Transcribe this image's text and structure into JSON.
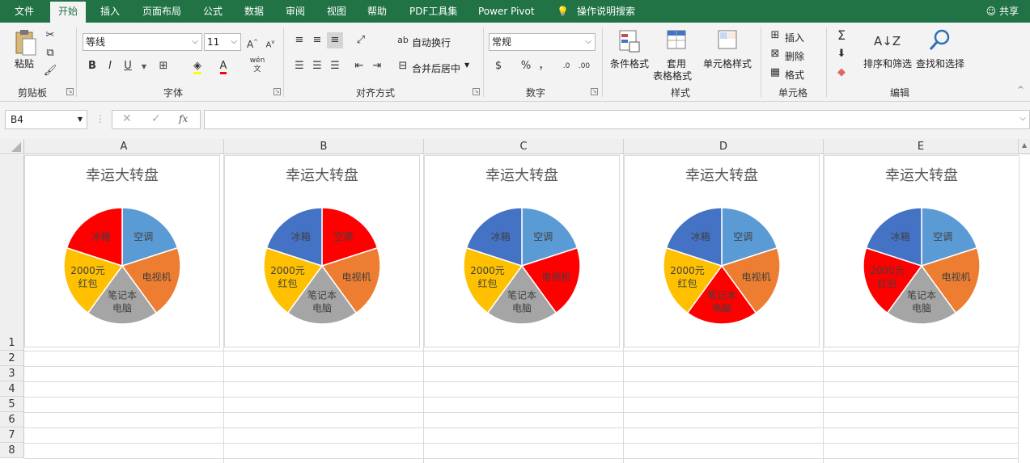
{
  "menu": {
    "tabs": [
      "文件",
      "开始",
      "插入",
      "页面布局",
      "公式",
      "数据",
      "审阅",
      "视图",
      "帮助",
      "PDF工具集",
      "Power Pivot"
    ],
    "search": "操作说明搜索",
    "share": "共享"
  },
  "ribbon": {
    "clipboard": {
      "paste": "粘贴",
      "label": "剪贴板"
    },
    "font": {
      "name": "等线",
      "size": "11",
      "bold": "B",
      "italic": "I",
      "underline": "U",
      "phonetic": "wén",
      "label": "字体"
    },
    "alignment": {
      "wrap": "自动换行",
      "merge": "合并后居中",
      "label": "对齐方式"
    },
    "number": {
      "format": "常规",
      "percent": "%",
      "comma": "，",
      "label": "数字"
    },
    "styles": {
      "conditional": "条件格式",
      "table_line1": "套用",
      "table_line2": "表格格式",
      "cell_styles": "单元格样式",
      "label": "样式"
    },
    "cells": {
      "insert": "插入",
      "delete": "删除",
      "format": "格式",
      "label": "单元格"
    },
    "editing": {
      "sort": "排序和筛选",
      "find": "查找和选择",
      "label": "编辑"
    }
  },
  "formula_bar": {
    "name_box": "B4",
    "fx": "fx",
    "value": ""
  },
  "columns": [
    "A",
    "B",
    "C",
    "D",
    "E"
  ],
  "rows": [
    "1",
    "2",
    "3",
    "4",
    "5",
    "6",
    "7",
    "8"
  ],
  "colors": {
    "blue_light": "#5b9bd5",
    "orange": "#ed7d31",
    "gray": "#a5a5a5",
    "yellow": "#ffc000",
    "red": "#ff0000",
    "blue_dark": "#4472c4",
    "excel_green": "#217346"
  },
  "chart_data": [
    {
      "type": "pie",
      "title": "幸运大转盘",
      "categories": [
        "空调",
        "电视机",
        "笔记本电脑",
        "2000元红包",
        "冰箱"
      ],
      "values": [
        1,
        1,
        1,
        1,
        1
      ],
      "colors": [
        "#5b9bd5",
        "#ed7d31",
        "#a5a5a5",
        "#ffc000",
        "#ff0000"
      ]
    },
    {
      "type": "pie",
      "title": "幸运大转盘",
      "categories": [
        "空调",
        "电视机",
        "笔记本电脑",
        "2000元红包",
        "冰箱"
      ],
      "values": [
        1,
        1,
        1,
        1,
        1
      ],
      "colors": [
        "#ff0000",
        "#ed7d31",
        "#a5a5a5",
        "#ffc000",
        "#4472c4"
      ]
    },
    {
      "type": "pie",
      "title": "幸运大转盘",
      "categories": [
        "空调",
        "电视机",
        "笔记本电脑",
        "2000元红包",
        "冰箱"
      ],
      "values": [
        1,
        1,
        1,
        1,
        1
      ],
      "colors": [
        "#5b9bd5",
        "#ff0000",
        "#a5a5a5",
        "#ffc000",
        "#4472c4"
      ]
    },
    {
      "type": "pie",
      "title": "幸运大转盘",
      "categories": [
        "空调",
        "电视机",
        "笔记本电脑",
        "2000元红包",
        "冰箱"
      ],
      "values": [
        1,
        1,
        1,
        1,
        1
      ],
      "colors": [
        "#5b9bd5",
        "#ed7d31",
        "#ff0000",
        "#ffc000",
        "#4472c4"
      ]
    },
    {
      "type": "pie",
      "title": "幸运大转盘",
      "categories": [
        "空调",
        "电视机",
        "笔记本电脑",
        "2000元红包",
        "冰箱"
      ],
      "values": [
        1,
        1,
        1,
        1,
        1
      ],
      "colors": [
        "#5b9bd5",
        "#ed7d31",
        "#a5a5a5",
        "#ff0000",
        "#4472c4"
      ]
    }
  ]
}
